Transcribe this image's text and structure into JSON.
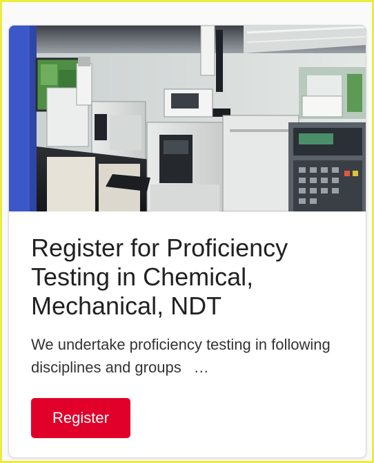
{
  "card": {
    "title": "Register for Proficiency Testing in Chemical, Mechanical, NDT",
    "description": "We undertake proficiency testing in following disciplines and groups",
    "ellipsis": "…",
    "button_label": "Register",
    "image_subject": "laboratory-instruments"
  },
  "colors": {
    "frame_border": "#ecec3a",
    "button_bg": "#e0002a",
    "button_text": "#ffffff",
    "title_text": "#212121",
    "body_text": "#333333"
  }
}
